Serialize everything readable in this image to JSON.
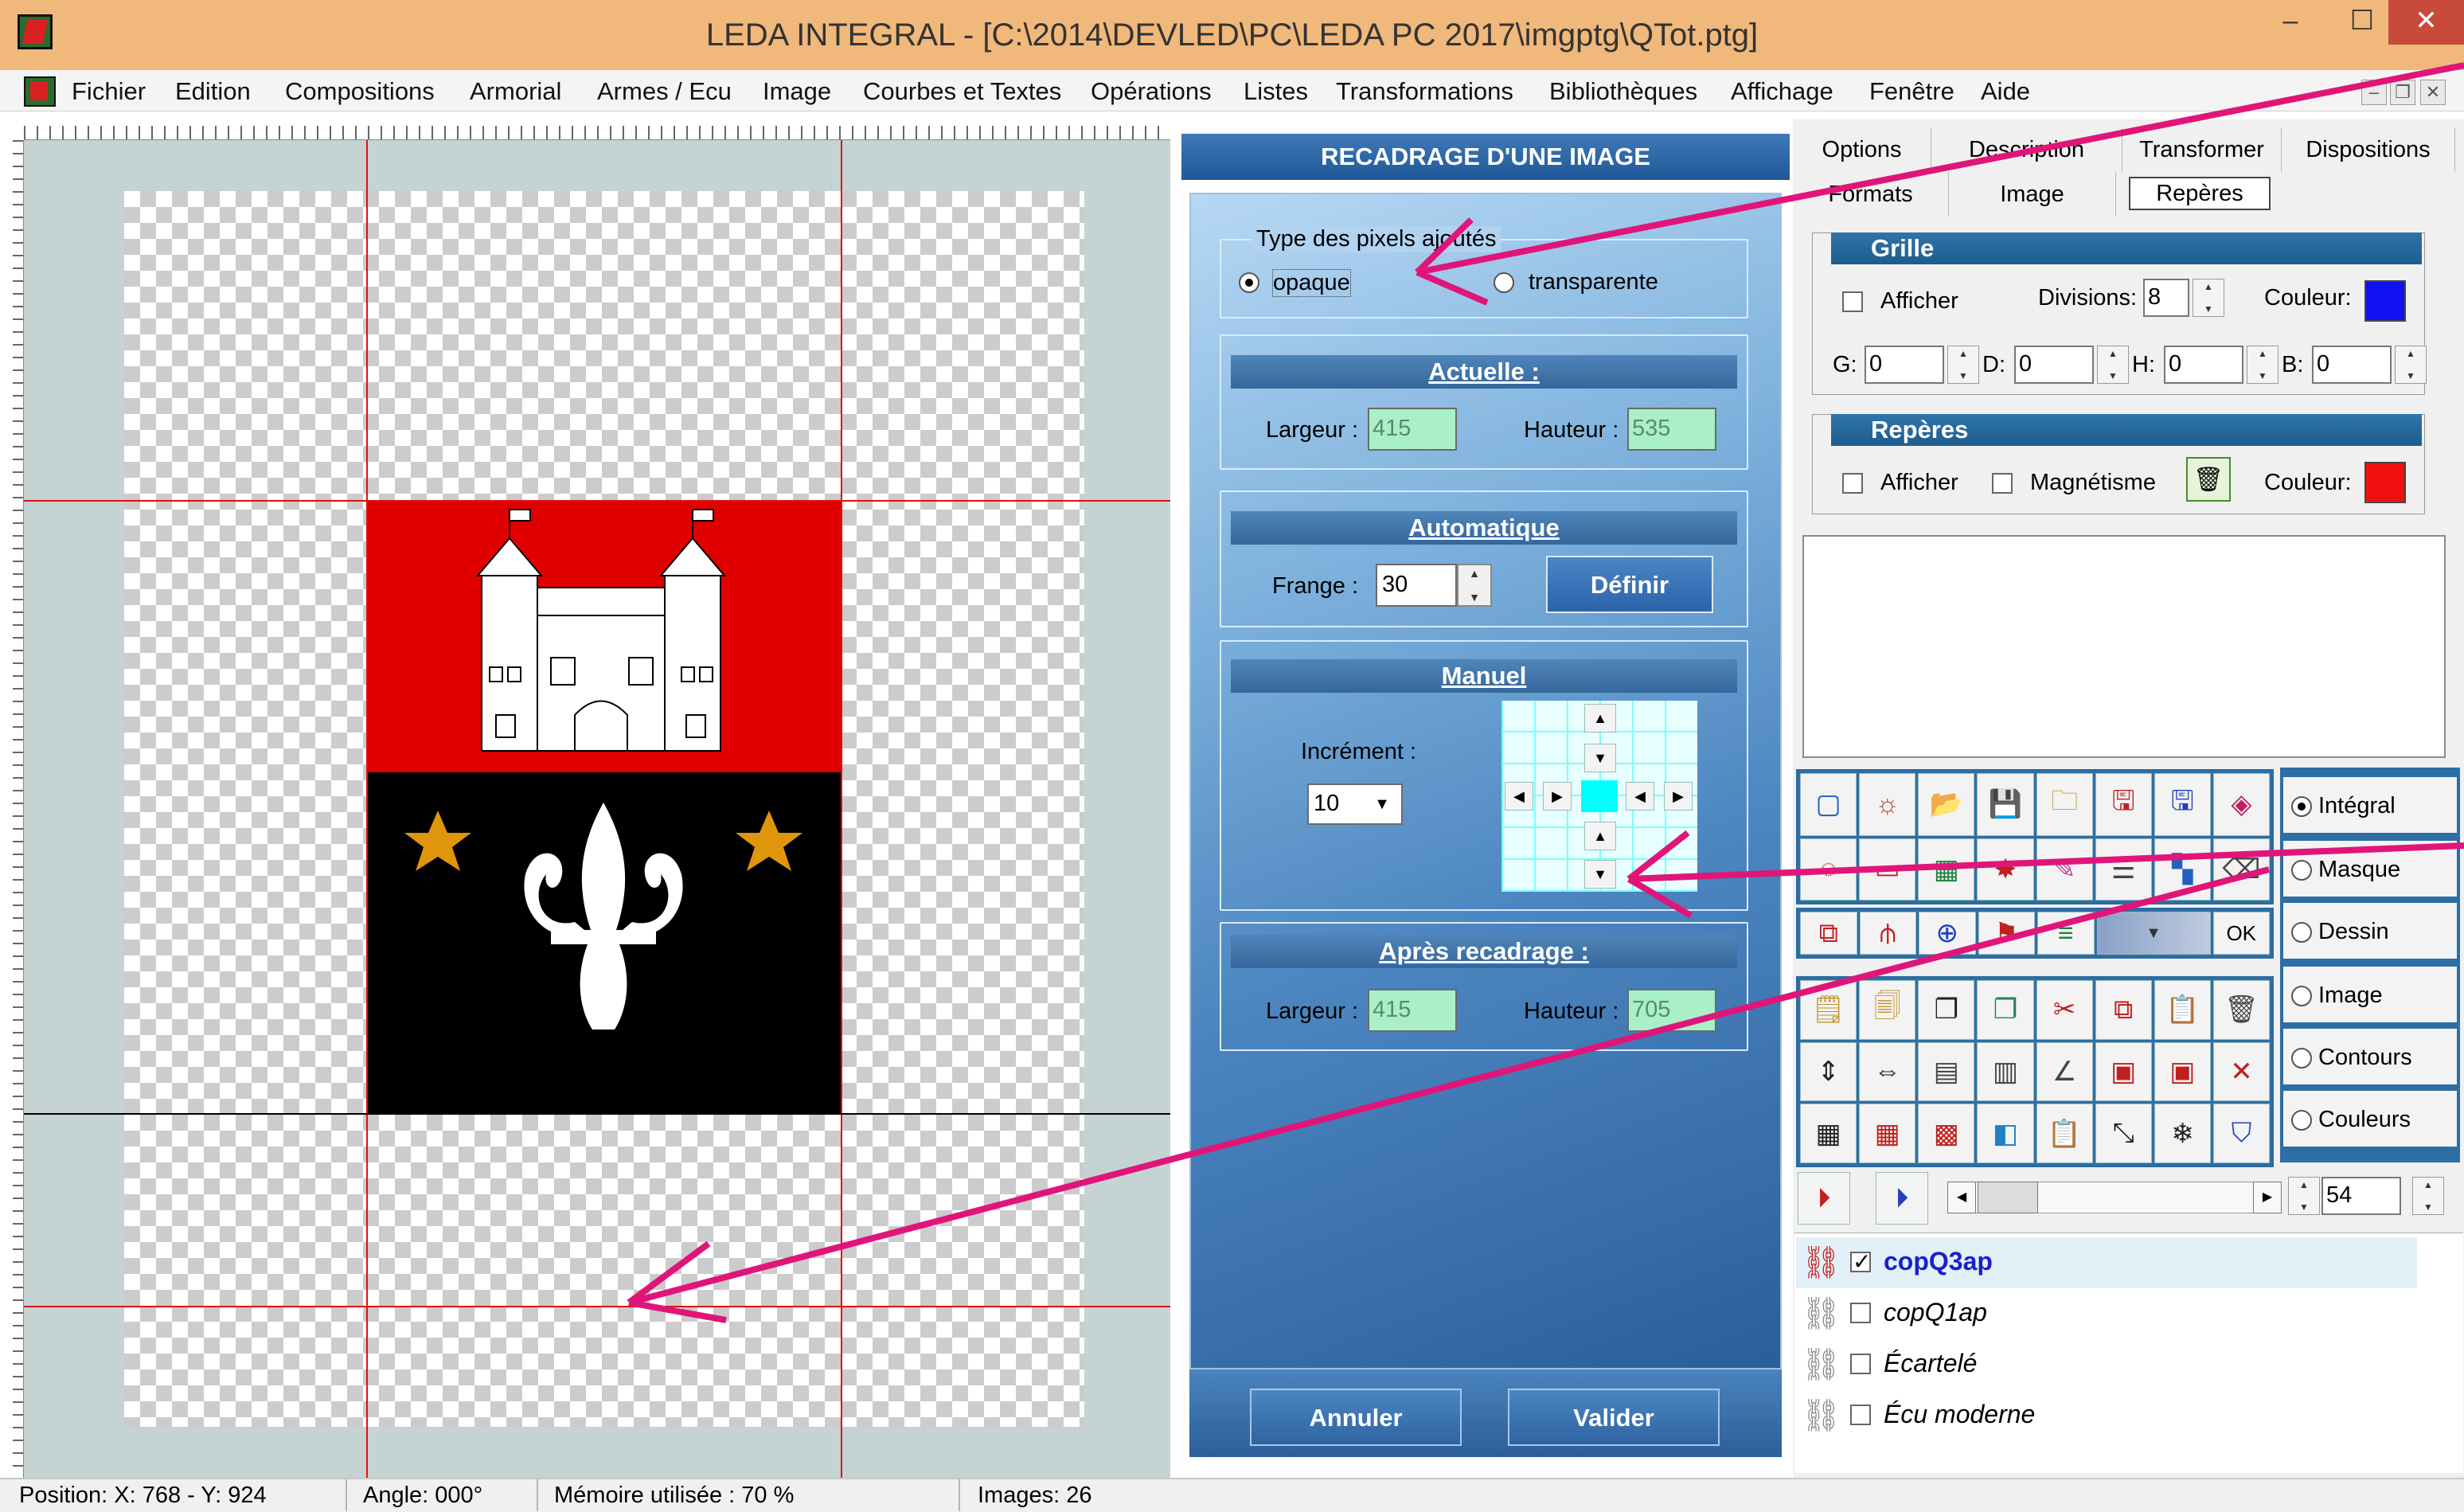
{
  "window": {
    "title": "LEDA INTEGRAL - [C:\\2014\\DEVLED\\PC\\LEDA PC 2017\\imgptg\\QTot.ptg]",
    "min_label": "–",
    "max_label": "☐",
    "close_label": "✕"
  },
  "menu": [
    "Fichier",
    "Edition",
    "Compositions",
    "Armorial",
    "Armes / Ecu",
    "Image",
    "Courbes et Textes",
    "Opérations",
    "Listes",
    "Transformations",
    "Bibliothèques",
    "Affichage",
    "Fenêtre",
    "Aide"
  ],
  "dialog": {
    "title": "RECADRAGE D'UNE IMAGE",
    "pixels": {
      "legend": "Type des pixels ajoutés",
      "opaque": "opaque",
      "transparente": "transparente",
      "selected": "opaque"
    },
    "actuelle": {
      "title": "Actuelle :",
      "largeur_label": "Largeur :",
      "largeur": "415",
      "hauteur_label": "Hauteur :",
      "hauteur": "535"
    },
    "automatique": {
      "title": "Automatique",
      "frange_label": "Frange :",
      "frange": "30",
      "definir": "Définir"
    },
    "manuel": {
      "title": "Manuel",
      "increment_label": "Incrément :",
      "increment": "10"
    },
    "apres": {
      "title": "Après recadrage :",
      "largeur_label": "Largeur :",
      "largeur": "415",
      "hauteur_label": "Hauteur :",
      "hauteur": "705"
    },
    "annuler": "Annuler",
    "valider": "Valider"
  },
  "tabs_row1": [
    "Options",
    "Description",
    "Transformer",
    "Dispositions"
  ],
  "tabs_row2": [
    "Formats",
    "Image",
    "Repères"
  ],
  "grille": {
    "title": "Grille",
    "afficher": "Afficher",
    "divisions_label": "Divisions:",
    "divisions": "8",
    "couleur_label": "Couleur:",
    "couleur": "#1010f0",
    "g_label": "G:",
    "g": "0",
    "d_label": "D:",
    "d": "0",
    "h_label": "H:",
    "h": "0",
    "b_label": "B:",
    "b": "0"
  },
  "reperes": {
    "title": "Repères",
    "afficher": "Afficher",
    "magnetisme": "Magnétisme",
    "couleur_label": "Couleur:",
    "couleur": "#f01010"
  },
  "modes": [
    {
      "label": "Intégral",
      "selected": true
    },
    {
      "label": "Masque",
      "selected": false
    },
    {
      "label": "Dessin",
      "selected": false
    },
    {
      "label": "Image",
      "selected": false
    },
    {
      "label": "Contours",
      "selected": false
    },
    {
      "label": "Couleurs",
      "selected": false
    }
  ],
  "ok_label": "OK",
  "zoom": "54",
  "layers": [
    {
      "name": "copQ3ap",
      "checked": true
    },
    {
      "name": "copQ1ap",
      "checked": false
    },
    {
      "name": "Écartelé",
      "checked": false
    },
    {
      "name": "Écu moderne",
      "checked": false
    }
  ],
  "status": {
    "position": "Position: X: 768 - Y: 924",
    "angle": "Angle: 000°",
    "memoire": "Mémoire utilisée : 70 %",
    "images": "Images: 26"
  },
  "colors": {
    "shield_red": "#e00000",
    "shield_black": "#000000",
    "gold_star": "#e0960a",
    "guide": "#e01010",
    "arrow": "#e0157a"
  }
}
